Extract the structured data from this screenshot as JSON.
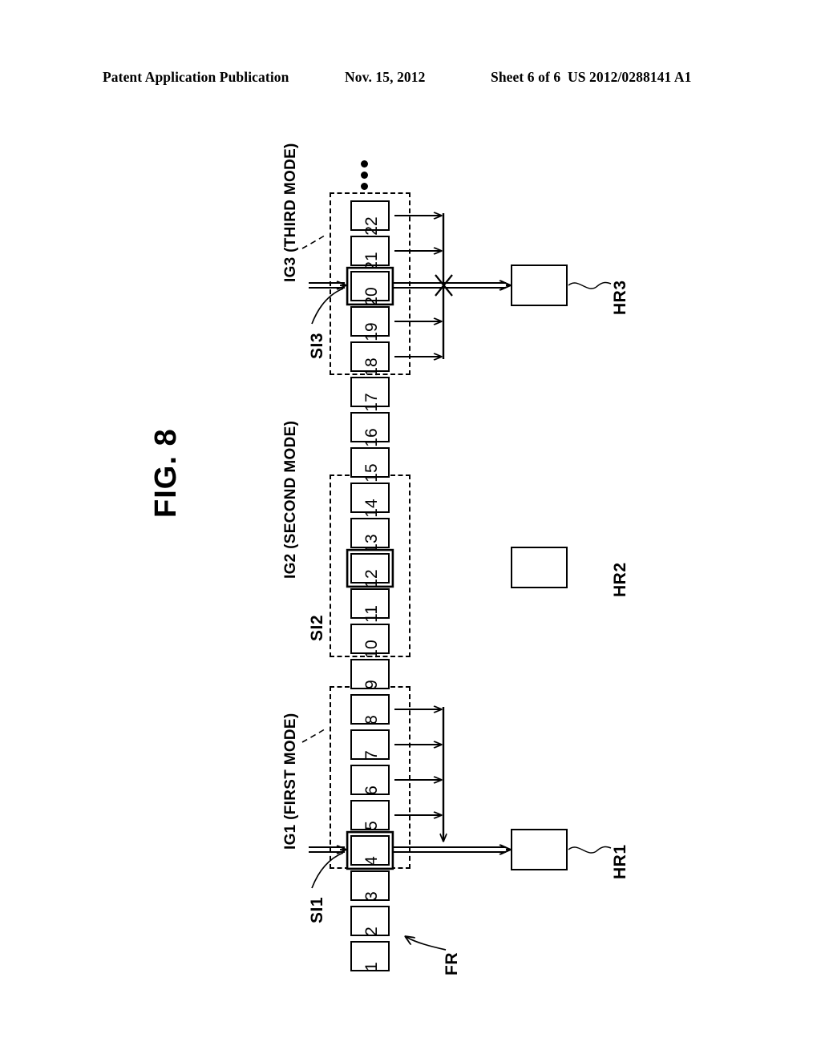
{
  "header": {
    "publication": "Patent Application Publication",
    "date": "Nov. 15, 2012",
    "sheet": "Sheet 6 of 6",
    "patent_number": "US 2012/0288141 A1"
  },
  "figure": {
    "title": "FIG. 8",
    "frame_sequence_label": "FR",
    "ellipsis": "•••",
    "frames": [
      {
        "id": 22,
        "selected": false
      },
      {
        "id": 21,
        "selected": false
      },
      {
        "id": 20,
        "selected": true
      },
      {
        "id": 19,
        "selected": false
      },
      {
        "id": 18,
        "selected": false
      },
      {
        "id": 17,
        "selected": false
      },
      {
        "id": 16,
        "selected": false
      },
      {
        "id": 15,
        "selected": false
      },
      {
        "id": 14,
        "selected": false
      },
      {
        "id": 13,
        "selected": false
      },
      {
        "id": 12,
        "selected": true
      },
      {
        "id": 11,
        "selected": false
      },
      {
        "id": 10,
        "selected": false
      },
      {
        "id": 9,
        "selected": false
      },
      {
        "id": 8,
        "selected": false
      },
      {
        "id": 7,
        "selected": false
      },
      {
        "id": 6,
        "selected": false
      },
      {
        "id": 5,
        "selected": false
      },
      {
        "id": 4,
        "selected": true
      },
      {
        "id": 3,
        "selected": false
      },
      {
        "id": 2,
        "selected": false
      },
      {
        "id": 1,
        "selected": false
      }
    ],
    "groups": [
      {
        "key": "ig3",
        "label": "IG3 (THIRD MODE)",
        "input_label": "SI3",
        "output_label": "HR3",
        "member_frames": [
          18,
          19,
          20,
          21,
          22
        ],
        "selected_frame": 20
      },
      {
        "key": "ig2",
        "label": "IG2 (SECOND MODE)",
        "input_label": "SI2",
        "output_label": "HR2",
        "member_frames": [
          10,
          11,
          12,
          13,
          14
        ],
        "selected_frame": 12
      },
      {
        "key": "ig1",
        "label": "IG1 (FIRST MODE)",
        "input_label": "SI1",
        "output_label": "HR1",
        "member_frames": [
          4,
          5,
          6,
          7,
          8
        ],
        "selected_frame": 4
      }
    ]
  },
  "colors": {
    "ink": "#000000",
    "paper": "#ffffff"
  }
}
